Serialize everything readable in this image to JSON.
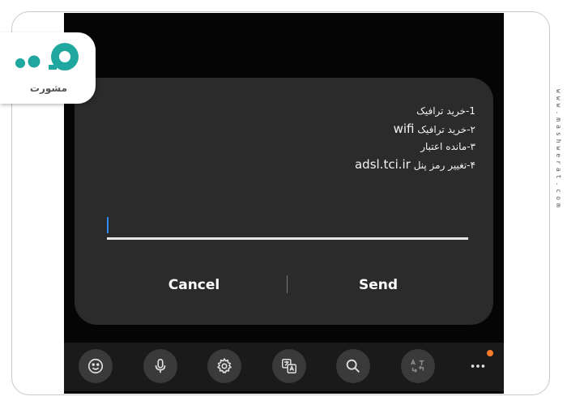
{
  "brand": {
    "logo_text": "مشورت",
    "watermark": "www.mashwerat.com"
  },
  "dialog": {
    "menu_items": [
      {
        "prefix": "1-",
        "text": "خرید ترافیک",
        "latin": ""
      },
      {
        "prefix": "۲-",
        "text": "خرید ترافیک",
        "latin": "wifi"
      },
      {
        "prefix": "۳-",
        "text": "مانده اعتبار",
        "latin": ""
      },
      {
        "prefix": "۴-",
        "text": "تغییر رمز پنل",
        "latin": "adsl.tci.ir"
      }
    ],
    "input_value": "",
    "cancel_label": "Cancel",
    "send_label": "Send"
  },
  "toolbar": {
    "icons": [
      "emoji-icon",
      "microphone-icon",
      "settings-icon",
      "translate-icon",
      "search-icon",
      "text-convert-icon",
      "more-icon"
    ]
  },
  "colors": {
    "dialog_bg": "#2b2b2b",
    "cursor": "#2f8cff",
    "brand_teal": "#1fa7a0",
    "notification_dot": "#ff7a2a"
  }
}
